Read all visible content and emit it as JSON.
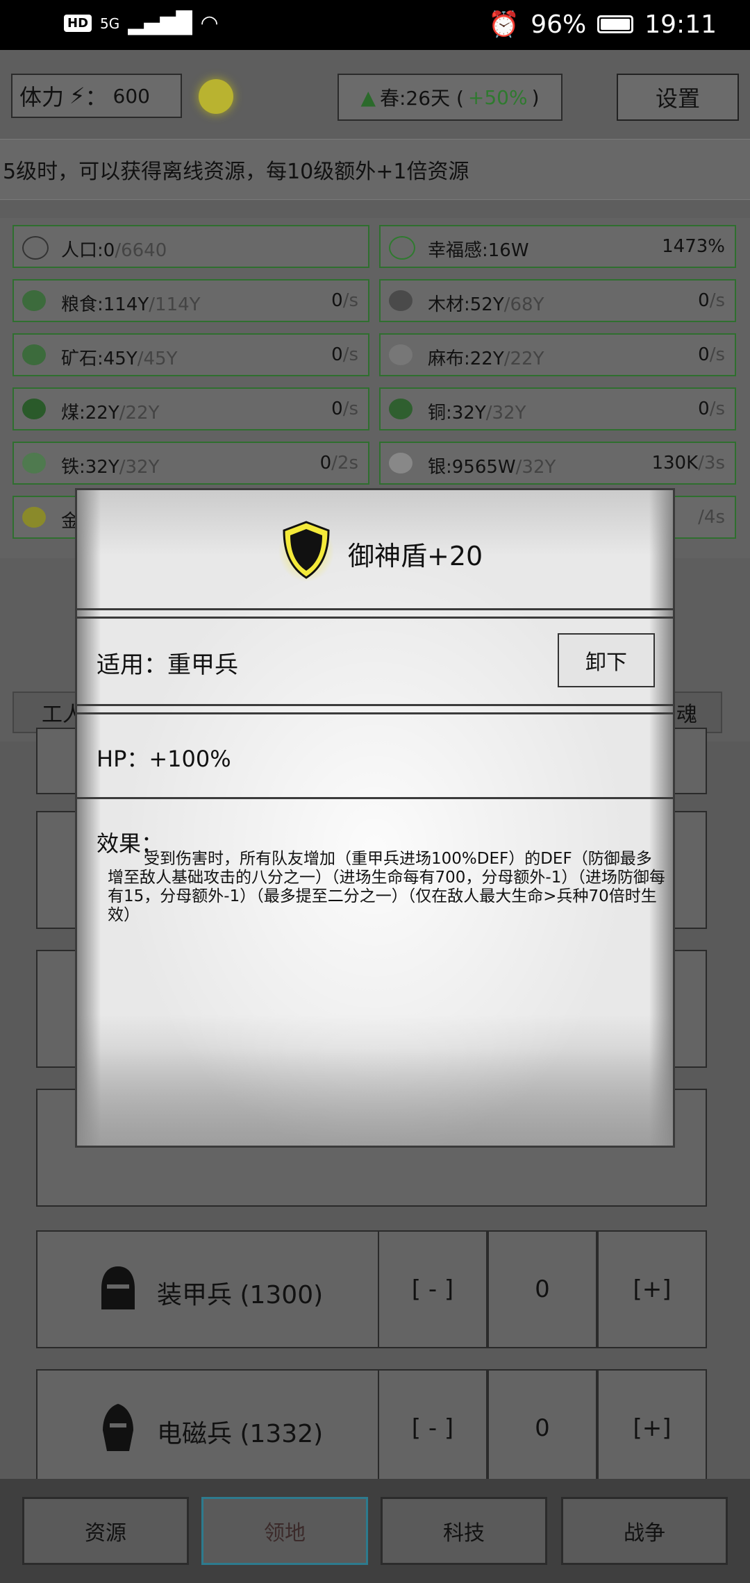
{
  "status_bar": {
    "hd": "HD",
    "network": "5G",
    "battery": "96%",
    "time": "19:11"
  },
  "top_bar": {
    "stamina_label": "体力",
    "stamina_sep": "：",
    "stamina_value": "600",
    "season_text": "春:26天 (",
    "season_bonus": "+50%",
    "season_close": ")",
    "settings_label": "设置"
  },
  "hint": "5级时，可以获得离线资源，每10级额外+1倍资源",
  "resources": [
    {
      "name": "人口:0",
      "max": "/6640",
      "rate": "",
      "unit": ""
    },
    {
      "name": "幸福感:16W",
      "max": "",
      "rate": "1473%",
      "unit": ""
    },
    {
      "name": "粮食:114Y",
      "max": "/114Y",
      "rate": "0",
      "unit": "/s"
    },
    {
      "name": "木材:52Y",
      "max": "/68Y",
      "rate": "0",
      "unit": "/s"
    },
    {
      "name": "矿石:45Y",
      "max": "/45Y",
      "rate": "0",
      "unit": "/s"
    },
    {
      "name": "麻布:22Y",
      "max": "/22Y",
      "rate": "0",
      "unit": "/s"
    },
    {
      "name": "煤:22Y",
      "max": "/22Y",
      "rate": "0",
      "unit": "/s"
    },
    {
      "name": "铜:32Y",
      "max": "/32Y",
      "rate": "0",
      "unit": "/s"
    },
    {
      "name": "铁:32Y",
      "max": "/32Y",
      "rate": "0",
      "unit": "/2s"
    },
    {
      "name": "银:9565W",
      "max": "/32Y",
      "rate": "130K",
      "unit": "/3s"
    },
    {
      "name": "金",
      "max": "",
      "rate": "",
      "unit": "/4s"
    }
  ],
  "tabs": {
    "left_partial": "工人",
    "right_partial": "魂"
  },
  "units": [
    {
      "name": "装甲兵 (1300)",
      "minus": "[ - ]",
      "count": "0",
      "plus": "[+]"
    },
    {
      "name": "电磁兵 (1332)",
      "minus": "[ - ]",
      "count": "0",
      "plus": "[+]"
    }
  ],
  "bottom_nav": [
    "资源",
    "领地",
    "科技",
    "战争"
  ],
  "modal": {
    "title": "御神盾+20",
    "applies": "适用：重甲兵",
    "unequip_label": "卸下",
    "hp": "HP：+100%",
    "effect_label": "效果：",
    "effect_text": "受到伤害时，所有队友增加（重甲兵进场100%DEF）的DEF（防御最多增至敌人基础攻击的八分之一）（进场生命每有700，分母额外-1）（进场防御每有15，分母额外-1）（最多提至二分之一）（仅在敌人最大生命>兵种70倍时生效）"
  },
  "colors": {
    "shield_glow": "#f4ea3a",
    "season_green": "#2f7a2f",
    "nav_active": "#2d7b8e"
  }
}
